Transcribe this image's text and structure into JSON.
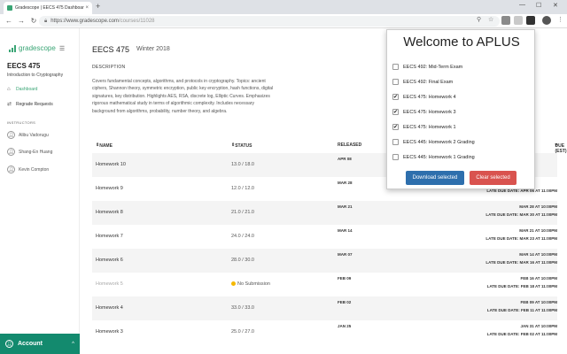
{
  "browser": {
    "tab_title": "Gradescope | EECS 475 Dashboar",
    "tab_close": "×",
    "new_tab": "+",
    "win_minimize": "—",
    "win_maximize": "☐",
    "win_close": "✕",
    "url_host": "https://www.gradescope.com",
    "url_path": "/courses/11028",
    "icons": [
      "back-icon",
      "forward-icon",
      "reload-icon",
      "lock-icon",
      "search-icon",
      "star-icon",
      "extension-icon",
      "profile-icon",
      "menu-icon"
    ]
  },
  "sidebar": {
    "logo_text": "gradescope",
    "course_name": "EECS 475",
    "course_desc": "Introduction to Cryptography",
    "nav": [
      {
        "label": "Dashboard",
        "icon": "home-icon"
      },
      {
        "label": "Regrade Requests",
        "icon": "regrade-icon"
      }
    ],
    "instructors_label": "INSTRUCTORS",
    "instructors": [
      "Alibu Vadorugu",
      "Shang-En Huang",
      "Kevin Compton"
    ],
    "account_label": "Account"
  },
  "main": {
    "course_title": "EECS 475",
    "term": "Winter 2018",
    "desc_heading": "DESCRIPTION",
    "desc_body": "Covers fundamental concepts, algorithms, and protocols in cryptography. Topics: ancient ciphers, Shannon theory, symmetric encryption, public key encryption, hash functions, digital signatures, key distribution. Highlights AES, RSA, discrete log, Elliptic Curves. Emphasizes rigorous mathematical study in terms of algorithmic complexity. Includes necessary background from algorithms, probability, number theory, and algebra.",
    "columns": {
      "name": "NAME",
      "status": "STATUS",
      "released": "RELEASED",
      "due": "DUE (EST)"
    },
    "rows": [
      {
        "name": "Homework 10",
        "status": "13.0 / 18.0",
        "released": "APR 08",
        "due": "",
        "late": ""
      },
      {
        "name": "Homework 9",
        "status": "12.0 / 12.0",
        "released": "MAR 28",
        "due": "",
        "late": "LATE DUE DATE: APR 06 AT 11:00PM"
      },
      {
        "name": "Homework 8",
        "status": "21.0 / 21.0",
        "released": "MAR 21",
        "due": "MAR 28 AT 10:00PM",
        "late": "LATE DUE DATE: MAR 30 AT 11:00PM"
      },
      {
        "name": "Homework 7",
        "status": "24.0 / 24.0",
        "released": "MAR 14",
        "due": "MAR 21 AT 10:00PM",
        "late": "LATE DUE DATE: MAR 23 AT 11:00PM"
      },
      {
        "name": "Homework 6",
        "status": "28.0 / 30.0",
        "released": "MAR 07",
        "due": "MAR 14 AT 10:00PM",
        "late": "LATE DUE DATE: MAR 16 AT 11:00PM"
      },
      {
        "name": "Homework 5",
        "status": "No Submission",
        "released": "FEB 09",
        "due": "FEB 16 AT 10:00PM",
        "late": "LATE DUE DATE: FEB 18 AT 11:00PM"
      },
      {
        "name": "Homework 4",
        "status": "33.0 / 33.0",
        "released": "FEB 02",
        "due": "FEB 09 AT 10:00PM",
        "late": "LATE DUE DATE: FEB 11 AT 11:00PM"
      },
      {
        "name": "Homework 3",
        "status": "25.0 / 27.0",
        "released": "JAN 25",
        "due": "JAN 31 AT 10:00PM",
        "late": "LATE DUE DATE: FEB 02 AT 11:00PM"
      }
    ]
  },
  "popup": {
    "title": "Welcome to APLUS",
    "items": [
      {
        "label": "EECS 492: Mid-Term Exam",
        "checked": false
      },
      {
        "label": "EECS 492: Final Exam",
        "checked": false
      },
      {
        "label": "EECS 475: Homework 4",
        "checked": true
      },
      {
        "label": "EECS 475: Homework 3",
        "checked": true
      },
      {
        "label": "EECS 475: Homework 1",
        "checked": true
      },
      {
        "label": "EECS 445: Homework 2 Grading",
        "checked": false
      },
      {
        "label": "EECS 445: Homework 1 Grading",
        "checked": false
      }
    ],
    "check_mark": "✔",
    "download_label": "Download selected",
    "clear_label": "Clear selected"
  }
}
